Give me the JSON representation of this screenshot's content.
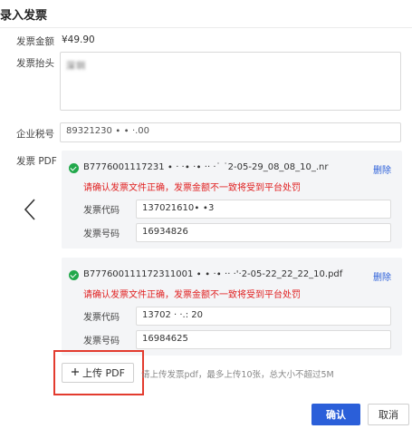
{
  "dialog": {
    "title": "录入发票"
  },
  "form": {
    "amount_label": "发票金额",
    "amount_value": "¥49.90",
    "header_label": "发票抬头",
    "header_value": "深圳",
    "tax_label": "企业税号",
    "tax_value": "89321230 ∙ ∙ ·.00",
    "pdf_label": "发票 PDF"
  },
  "pdfs": [
    {
      "filename": "B7776001117231 ∙ · ·∙  ·∙ ·· ·˙ ˙2-05-29_08_08_10_.nr",
      "delete_label": "删除",
      "warning": "请确认发票文件正确，发票金额不一致将受到平台处罚",
      "code_label": "发票代码",
      "code_value": "137021610∙ ∙3",
      "number_label": "发票号码",
      "number_value": "16934826"
    },
    {
      "filename": "B777600111172311001 ∙ ∙ ·∙ ·· ·'·2-05-22_22_22_10.pdf",
      "delete_label": "删除",
      "warning": "请确认发票文件正确，发票金额不一致将受到平台处罚",
      "code_label": "发票代码",
      "code_value": "13702 ·  ·.: 20",
      "number_label": "发票号码",
      "number_value": "16984625"
    }
  ],
  "upload": {
    "button_label": "上传 PDF",
    "hint": "请上传发票pdf，最多上传10张，总大小不超过5M"
  },
  "footer": {
    "confirm_label": "确认",
    "cancel_label": "取消"
  },
  "icons": {
    "back": "chevron-left-icon",
    "check": "check-circle-icon",
    "plus": "plus-icon"
  },
  "colors": {
    "primary": "#2b5fd9",
    "warning": "#e02020",
    "success": "#21a84b",
    "highlight": "#e33b2e"
  }
}
